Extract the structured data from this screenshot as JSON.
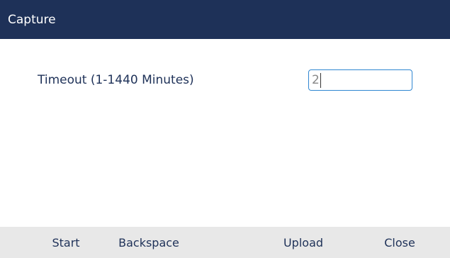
{
  "header": {
    "title": "Capture"
  },
  "form": {
    "timeout_label": "Timeout (1-1440 Minutes)",
    "timeout_value": "2"
  },
  "softkeys": {
    "start": "Start",
    "backspace": "Backspace",
    "upload": "Upload",
    "close": "Close"
  },
  "colors": {
    "title_bar": "#1e3158",
    "text_primary": "#1e3158",
    "input_border": "#2f86d1",
    "softkey_bar": "#e8e8e8"
  }
}
